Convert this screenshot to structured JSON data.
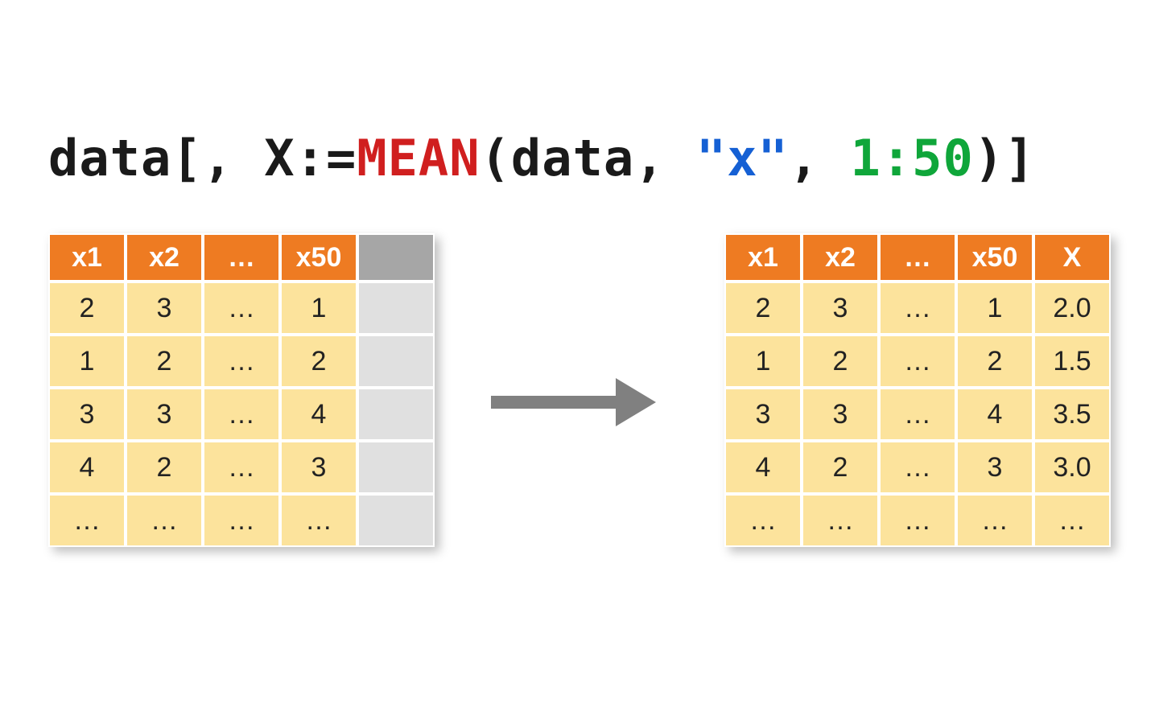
{
  "code": {
    "p1": "data[, X:=",
    "p2_mean": "MEAN",
    "p3": "(data, ",
    "p4_str": "\"x\"",
    "p5": ", ",
    "p6_range": "1:50",
    "p7": ")]"
  },
  "colors": {
    "header_bg": "#ee7b22",
    "cell_bg": "#fce39c",
    "blank_header_bg": "#a6a6a6",
    "blank_cell_bg": "#e0e0e0",
    "arrow": "#808080",
    "syntax_red": "#d01f1f",
    "syntax_blue": "#1560d4",
    "syntax_green": "#0fa63a"
  },
  "left_table": {
    "headers": [
      "x1",
      "x2",
      "…",
      "x50",
      ""
    ],
    "rows": [
      [
        "2",
        "3",
        "…",
        "1",
        ""
      ],
      [
        "1",
        "2",
        "…",
        "2",
        ""
      ],
      [
        "3",
        "3",
        "…",
        "4",
        ""
      ],
      [
        "4",
        "2",
        "…",
        "3",
        ""
      ],
      [
        "…",
        "…",
        "…",
        "…",
        ""
      ]
    ]
  },
  "right_table": {
    "headers": [
      "x1",
      "x2",
      "…",
      "x50",
      "X"
    ],
    "rows": [
      [
        "2",
        "3",
        "…",
        "1",
        "2.0"
      ],
      [
        "1",
        "2",
        "…",
        "2",
        "1.5"
      ],
      [
        "3",
        "3",
        "…",
        "4",
        "3.5"
      ],
      [
        "4",
        "2",
        "…",
        "3",
        "3.0"
      ],
      [
        "…",
        "…",
        "…",
        "…",
        "…"
      ]
    ]
  }
}
